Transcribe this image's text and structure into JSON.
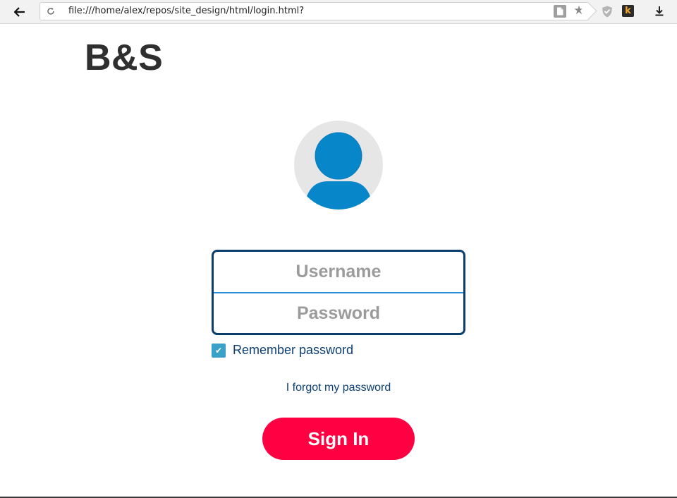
{
  "browser": {
    "url": "file:///home/alex/repos/site_design/html/login.html?",
    "icons": [
      "back-arrow-icon",
      "reload-icon",
      "page-info-icon",
      "star-icon",
      "shield-icon",
      "k-extension-icon",
      "download-icon"
    ]
  },
  "page": {
    "brand": "B&S",
    "form": {
      "username_placeholder": "Username",
      "username_value": "",
      "password_placeholder": "Password",
      "password_value": "",
      "remember_label": "Remember password",
      "remember_checked": true,
      "forgot_link": "I forgot my password",
      "submit_label": "Sign In"
    }
  },
  "colors": {
    "brand_text": "#2f2f2f",
    "form_border": "#0a3d6b",
    "divider": "#2a8fd6",
    "avatar_bg": "#e6e6e6",
    "avatar_fg": "#0787c9",
    "checkbox": "#3aa1c8",
    "link": "#0d3f73",
    "signin_bg": "#ff0042"
  }
}
